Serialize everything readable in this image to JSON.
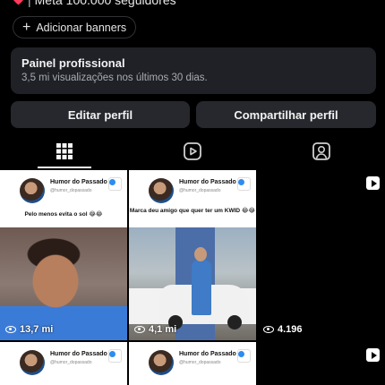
{
  "profile": {
    "goal_text": "Meta 100.000 seguidores",
    "add_banners_label": "Adicionar banners"
  },
  "pro_panel": {
    "title": "Painel profissional",
    "subtitle": "3,5 mi visualizações nos últimos 30 dias."
  },
  "buttons": {
    "edit_profile": "Editar perfil",
    "share_profile": "Compartilhar perfil"
  },
  "tabs": [
    {
      "name": "grid",
      "icon": "grid-icon",
      "active": true
    },
    {
      "name": "reels",
      "icon": "reels-icon",
      "active": false
    },
    {
      "name": "tagged",
      "icon": "tagged-icon",
      "active": false
    }
  ],
  "posts": [
    {
      "account": "Humor do Passado",
      "handle": "@humor_dopassado",
      "caption": "Pelo menos evita o sol 😂😂",
      "views": "13,7 mi"
    },
    {
      "account": "Humor do Passado",
      "handle": "@humor_dopassado",
      "caption": "Marca deu amigo que quer ter um KWID 😂😂",
      "views": "4,1 mi"
    },
    {
      "views": "4.196"
    },
    {
      "account": "Humor do Passado",
      "handle": "@humor_dopassado"
    },
    {
      "account": "Humor do Passado",
      "handle": "@humor_dopassado"
    },
    {}
  ],
  "colors": {
    "background": "#000000",
    "panel": "#1f2126",
    "button": "#26282d",
    "verified": "#2d8cf0",
    "heart": "#ff3b5c"
  }
}
